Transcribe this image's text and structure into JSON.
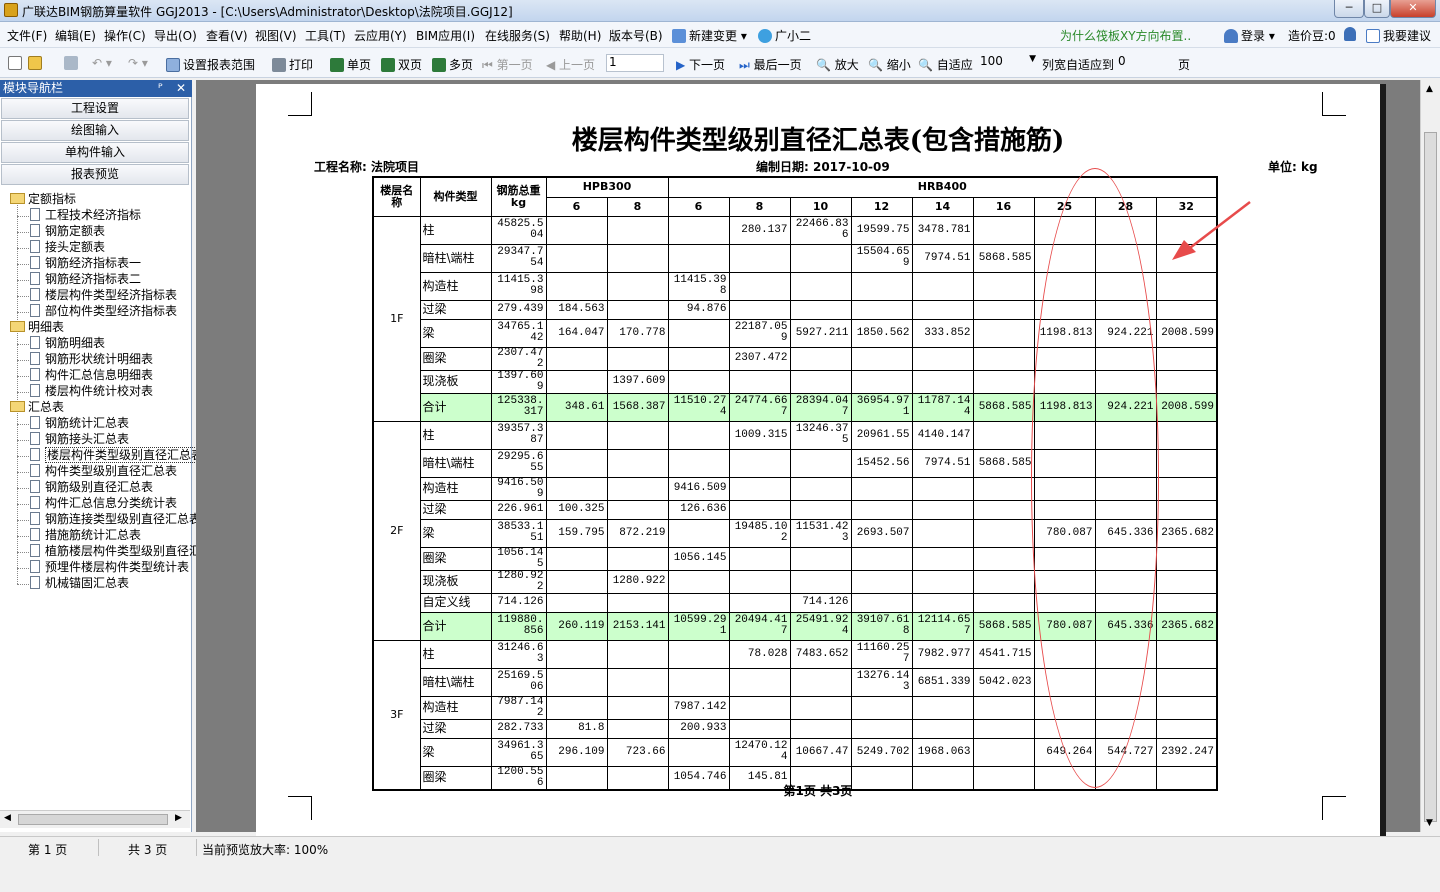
{
  "window": {
    "title": "广联达BIM钢筋算量软件 GGJ2013 - [C:\\Users\\Administrator\\Desktop\\法院项目.GGJ12]",
    "buttons": [
      "─",
      "□",
      "✕"
    ]
  },
  "menubar": {
    "items": [
      "文件(F)",
      "编辑(E)",
      "操作(C)",
      "导出(O)",
      "查看(V)",
      "视图(V)",
      "工具(T)",
      "云应用(Y)",
      "BIM应用(I)",
      "在线服务(S)",
      "帮助(H)",
      "版本号(B)",
      "新建变更 ▾",
      "广小二"
    ],
    "promo": "为什么筏板XY方向布置..",
    "login": "登录 ▾",
    "coins": "造价豆:0",
    "suggest": "我要建议"
  },
  "toolbar": {
    "set_range": "设置报表范围",
    "print": "打印",
    "single": "单页",
    "double": "双页",
    "multi": "多页",
    "first": "第一页",
    "prev": "上一页",
    "page_input": "1",
    "next": "下一页",
    "last": "最后一页",
    "zoom_in": "放大",
    "zoom_out": "缩小",
    "fit": "自适应",
    "zoom_value": "100",
    "fit_width": "列宽自适应到",
    "col_value": "0",
    "page_unit": "页"
  },
  "nav": {
    "header": "模块导航栏",
    "pin": "ᴾ",
    "close": "✕",
    "buttons": [
      "工程设置",
      "绘图输入",
      "单构件输入",
      "报表预览"
    ],
    "tree": [
      {
        "label": "定额指标",
        "folder": true
      },
      {
        "label": "工程技术经济指标"
      },
      {
        "label": "钢筋定额表"
      },
      {
        "label": "接头定额表"
      },
      {
        "label": "钢筋经济指标表一"
      },
      {
        "label": "钢筋经济指标表二"
      },
      {
        "label": "楼层构件类型经济指标表"
      },
      {
        "label": "部位构件类型经济指标表"
      },
      {
        "label": "明细表",
        "folder": true
      },
      {
        "label": "钢筋明细表"
      },
      {
        "label": "钢筋形状统计明细表"
      },
      {
        "label": "构件汇总信息明细表"
      },
      {
        "label": "楼层构件统计校对表"
      },
      {
        "label": "汇总表",
        "folder": true
      },
      {
        "label": "钢筋统计汇总表"
      },
      {
        "label": "钢筋接头汇总表"
      },
      {
        "label": "楼层构件类型级别直径汇总表",
        "selected": true
      },
      {
        "label": "构件类型级别直径汇总表"
      },
      {
        "label": "钢筋级别直径汇总表"
      },
      {
        "label": "构件汇总信息分类统计表"
      },
      {
        "label": "钢筋连接类型级别直径汇总表"
      },
      {
        "label": "措施筋统计汇总表"
      },
      {
        "label": "植筋楼层构件类型级别直径汇总表"
      },
      {
        "label": "预埋件楼层构件类型统计表"
      },
      {
        "label": "机械锚固汇总表"
      }
    ]
  },
  "report": {
    "title": "楼层构件类型级别直径汇总表(包含措施筋)",
    "project": "工程名称: 法院项目",
    "date": "编制日期: 2017-10-09",
    "unit": "单位: kg",
    "headers": {
      "floor": "楼层名称",
      "type": "构件类型",
      "weight": "钢筋总重kg",
      "hpb": "HPB300",
      "hrb": "HRB400",
      "hpb_d": [
        "6",
        "8"
      ],
      "hrb_d": [
        "6",
        "8",
        "10",
        "12",
        "14",
        "16",
        "25",
        "28",
        "32"
      ]
    },
    "floors": [
      {
        "name": "1F",
        "rows": [
          {
            "type": "柱",
            "w": "45825.504",
            "v": [
              "",
              "",
              "",
              "280.137",
              "22466.836",
              "19599.75",
              "3478.781",
              "",
              "",
              "",
              ""
            ]
          },
          {
            "type": "暗柱\\端柱",
            "w": "29347.754",
            "v": [
              "",
              "",
              "",
              "",
              "",
              "15504.659",
              "7974.51",
              "5868.585",
              "",
              "",
              ""
            ]
          },
          {
            "type": "构造柱",
            "w": "11415.398",
            "v": [
              "",
              "",
              "11415.398",
              "",
              "",
              "",
              "",
              "",
              "",
              "",
              ""
            ]
          },
          {
            "type": "过梁",
            "w": "279.439",
            "v": [
              "184.563",
              "",
              "94.876",
              "",
              "",
              "",
              "",
              "",
              "",
              "",
              ""
            ]
          },
          {
            "type": "梁",
            "w": "34765.142",
            "v": [
              "164.047",
              "170.778",
              "",
              "22187.059",
              "5927.211",
              "1850.562",
              "333.852",
              "",
              "1198.813",
              "924.221",
              "2008.599"
            ]
          },
          {
            "type": "圈梁",
            "w": "2307.472",
            "v": [
              "",
              "",
              "",
              "2307.472",
              "",
              "",
              "",
              "",
              "",
              "",
              ""
            ]
          },
          {
            "type": "现浇板",
            "w": "1397.609",
            "v": [
              "",
              "1397.609",
              "",
              "",
              "",
              "",
              "",
              "",
              "",
              "",
              ""
            ]
          },
          {
            "type": "合计",
            "sum": true,
            "w": "125338.317",
            "v": [
              "348.61",
              "1568.387",
              "11510.274",
              "24774.667",
              "28394.047",
              "36954.971",
              "11787.144",
              "5868.585",
              "1198.813",
              "924.221",
              "2008.599"
            ]
          }
        ]
      },
      {
        "name": "2F",
        "rows": [
          {
            "type": "柱",
            "w": "39357.387",
            "v": [
              "",
              "",
              "",
              "1009.315",
              "13246.375",
              "20961.55",
              "4140.147",
              "",
              "",
              "",
              ""
            ]
          },
          {
            "type": "暗柱\\端柱",
            "w": "29295.655",
            "v": [
              "",
              "",
              "",
              "",
              "",
              "15452.56",
              "7974.51",
              "5868.585",
              "",
              "",
              ""
            ]
          },
          {
            "type": "构造柱",
            "w": "9416.509",
            "v": [
              "",
              "",
              "9416.509",
              "",
              "",
              "",
              "",
              "",
              "",
              "",
              ""
            ]
          },
          {
            "type": "过梁",
            "w": "226.961",
            "v": [
              "100.325",
              "",
              "126.636",
              "",
              "",
              "",
              "",
              "",
              "",
              "",
              ""
            ]
          },
          {
            "type": "梁",
            "w": "38533.151",
            "v": [
              "159.795",
              "872.219",
              "",
              "19485.102",
              "11531.423",
              "2693.507",
              "",
              "",
              "780.087",
              "645.336",
              "2365.682"
            ]
          },
          {
            "type": "圈梁",
            "w": "1056.145",
            "v": [
              "",
              "",
              "1056.145",
              "",
              "",
              "",
              "",
              "",
              "",
              "",
              ""
            ]
          },
          {
            "type": "现浇板",
            "w": "1280.922",
            "v": [
              "",
              "1280.922",
              "",
              "",
              "",
              "",
              "",
              "",
              "",
              "",
              ""
            ]
          },
          {
            "type": "自定义线",
            "w": "714.126",
            "v": [
              "",
              "",
              "",
              "",
              "714.126",
              "",
              "",
              "",
              "",
              "",
              ""
            ]
          },
          {
            "type": "合计",
            "sum": true,
            "w": "119880.856",
            "v": [
              "260.119",
              "2153.141",
              "10599.291",
              "20494.417",
              "25491.924",
              "39107.618",
              "12114.657",
              "5868.585",
              "780.087",
              "645.336",
              "2365.682"
            ]
          }
        ]
      },
      {
        "name": "3F",
        "rows": [
          {
            "type": "柱",
            "w": "31246.63",
            "v": [
              "",
              "",
              "",
              "78.028",
              "7483.652",
              "11160.257",
              "7982.977",
              "4541.715",
              "",
              "",
              ""
            ]
          },
          {
            "type": "暗柱\\端柱",
            "w": "25169.506",
            "v": [
              "",
              "",
              "",
              "",
              "",
              "13276.143",
              "6851.339",
              "5042.023",
              "",
              "",
              ""
            ]
          },
          {
            "type": "构造柱",
            "w": "7987.142",
            "v": [
              "",
              "",
              "7987.142",
              "",
              "",
              "",
              "",
              "",
              "",
              "",
              ""
            ]
          },
          {
            "type": "过梁",
            "w": "282.733",
            "v": [
              "81.8",
              "",
              "200.933",
              "",
              "",
              "",
              "",
              "",
              "",
              "",
              ""
            ]
          },
          {
            "type": "梁",
            "w": "34961.365",
            "v": [
              "296.109",
              "723.66",
              "",
              "12470.124",
              "10667.47",
              "5249.702",
              "1968.063",
              "",
              "649.264",
              "544.727",
              "2392.247"
            ]
          },
          {
            "type": "圈梁",
            "w": "1200.556",
            "v": [
              "",
              "",
              "1054.746",
              "145.81",
              "",
              "",
              "",
              "",
              "",
              "",
              ""
            ]
          }
        ]
      }
    ],
    "footer": "第1页  共3页"
  },
  "status": {
    "page": "第 1 页",
    "total": "共 3 页",
    "zoom": "当前预览放大率: 100%"
  },
  "colors": {
    "sum_row": "#ccffcc",
    "annotation": "#e74b4b",
    "nav_header": "#2c5fa8"
  }
}
